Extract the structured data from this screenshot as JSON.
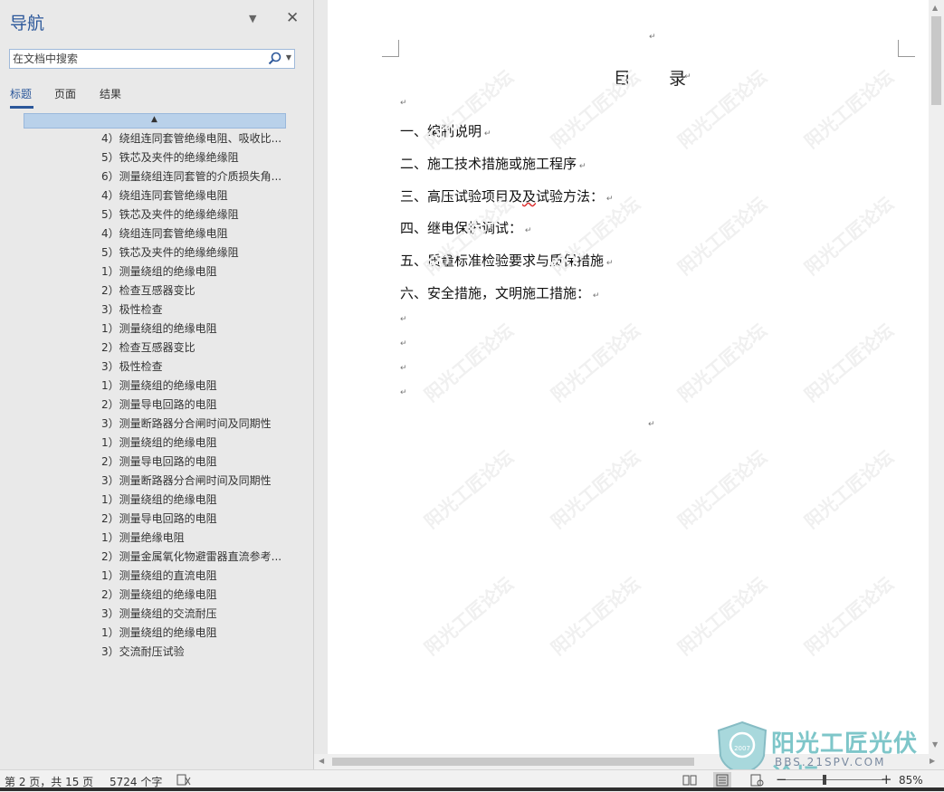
{
  "nav": {
    "title": "导航",
    "search_placeholder": "在文档中搜索",
    "tabs": [
      "标题",
      "页面",
      "结果"
    ],
    "headings": [
      "4）绕组连同套管绝缘电阻、吸收比...",
      "5）铁芯及夹件的绝缘绝缘阻",
      "6）测量绕组连同套管的介质损失角...",
      "4）绕组连同套管绝缘电阻",
      "5）铁芯及夹件的绝缘绝缘阻",
      "4）绕组连同套管绝缘电阻",
      "5）铁芯及夹件的绝缘绝缘阻",
      "1）测量绕组的绝缘电阻",
      "2）检查互感器变比",
      "3）极性检查",
      "1）测量绕组的绝缘电阻",
      "2）检查互感器变比",
      "3）极性检查",
      "1）测量绕组的绝缘电阻",
      "2）测量导电回路的电阻",
      "3）测量断路器分合闸时间及同期性",
      "1）测量绕组的绝缘电阻",
      "2）测量导电回路的电阻",
      "3）测量断路器分合闸时间及同期性",
      "1）测量绕组的绝缘电阻",
      "2）测量导电回路的电阻",
      "1）测量绝缘电阻",
      "2）测量金属氧化物避雷器直流参考...",
      "1）测量绕组的直流电阻",
      "2）测量绕组的绝缘电阻",
      "3）测量绕组的交流耐压",
      "1）测量绕组的绝缘电阻",
      "3）交流耐压试验"
    ]
  },
  "document": {
    "title": "目录",
    "toc": [
      "一、编制说明",
      "二、施工技术措施或施工程序",
      "三、高压试验项目及及试验方法：",
      "四、继电保护调试：",
      "五、质量标准检验要求与质保措施",
      "六、安全措施，文明施工措施："
    ],
    "watermark": "阳光工匠论坛"
  },
  "logo": {
    "name": "阳光工匠光伏论坛",
    "url": "BBS.21SPV.COM",
    "year": "2007"
  },
  "status": {
    "page": "第 2 页，共 15 页",
    "words": "5724 个字",
    "zoom": "85%",
    "zoom_level": 0.85
  }
}
